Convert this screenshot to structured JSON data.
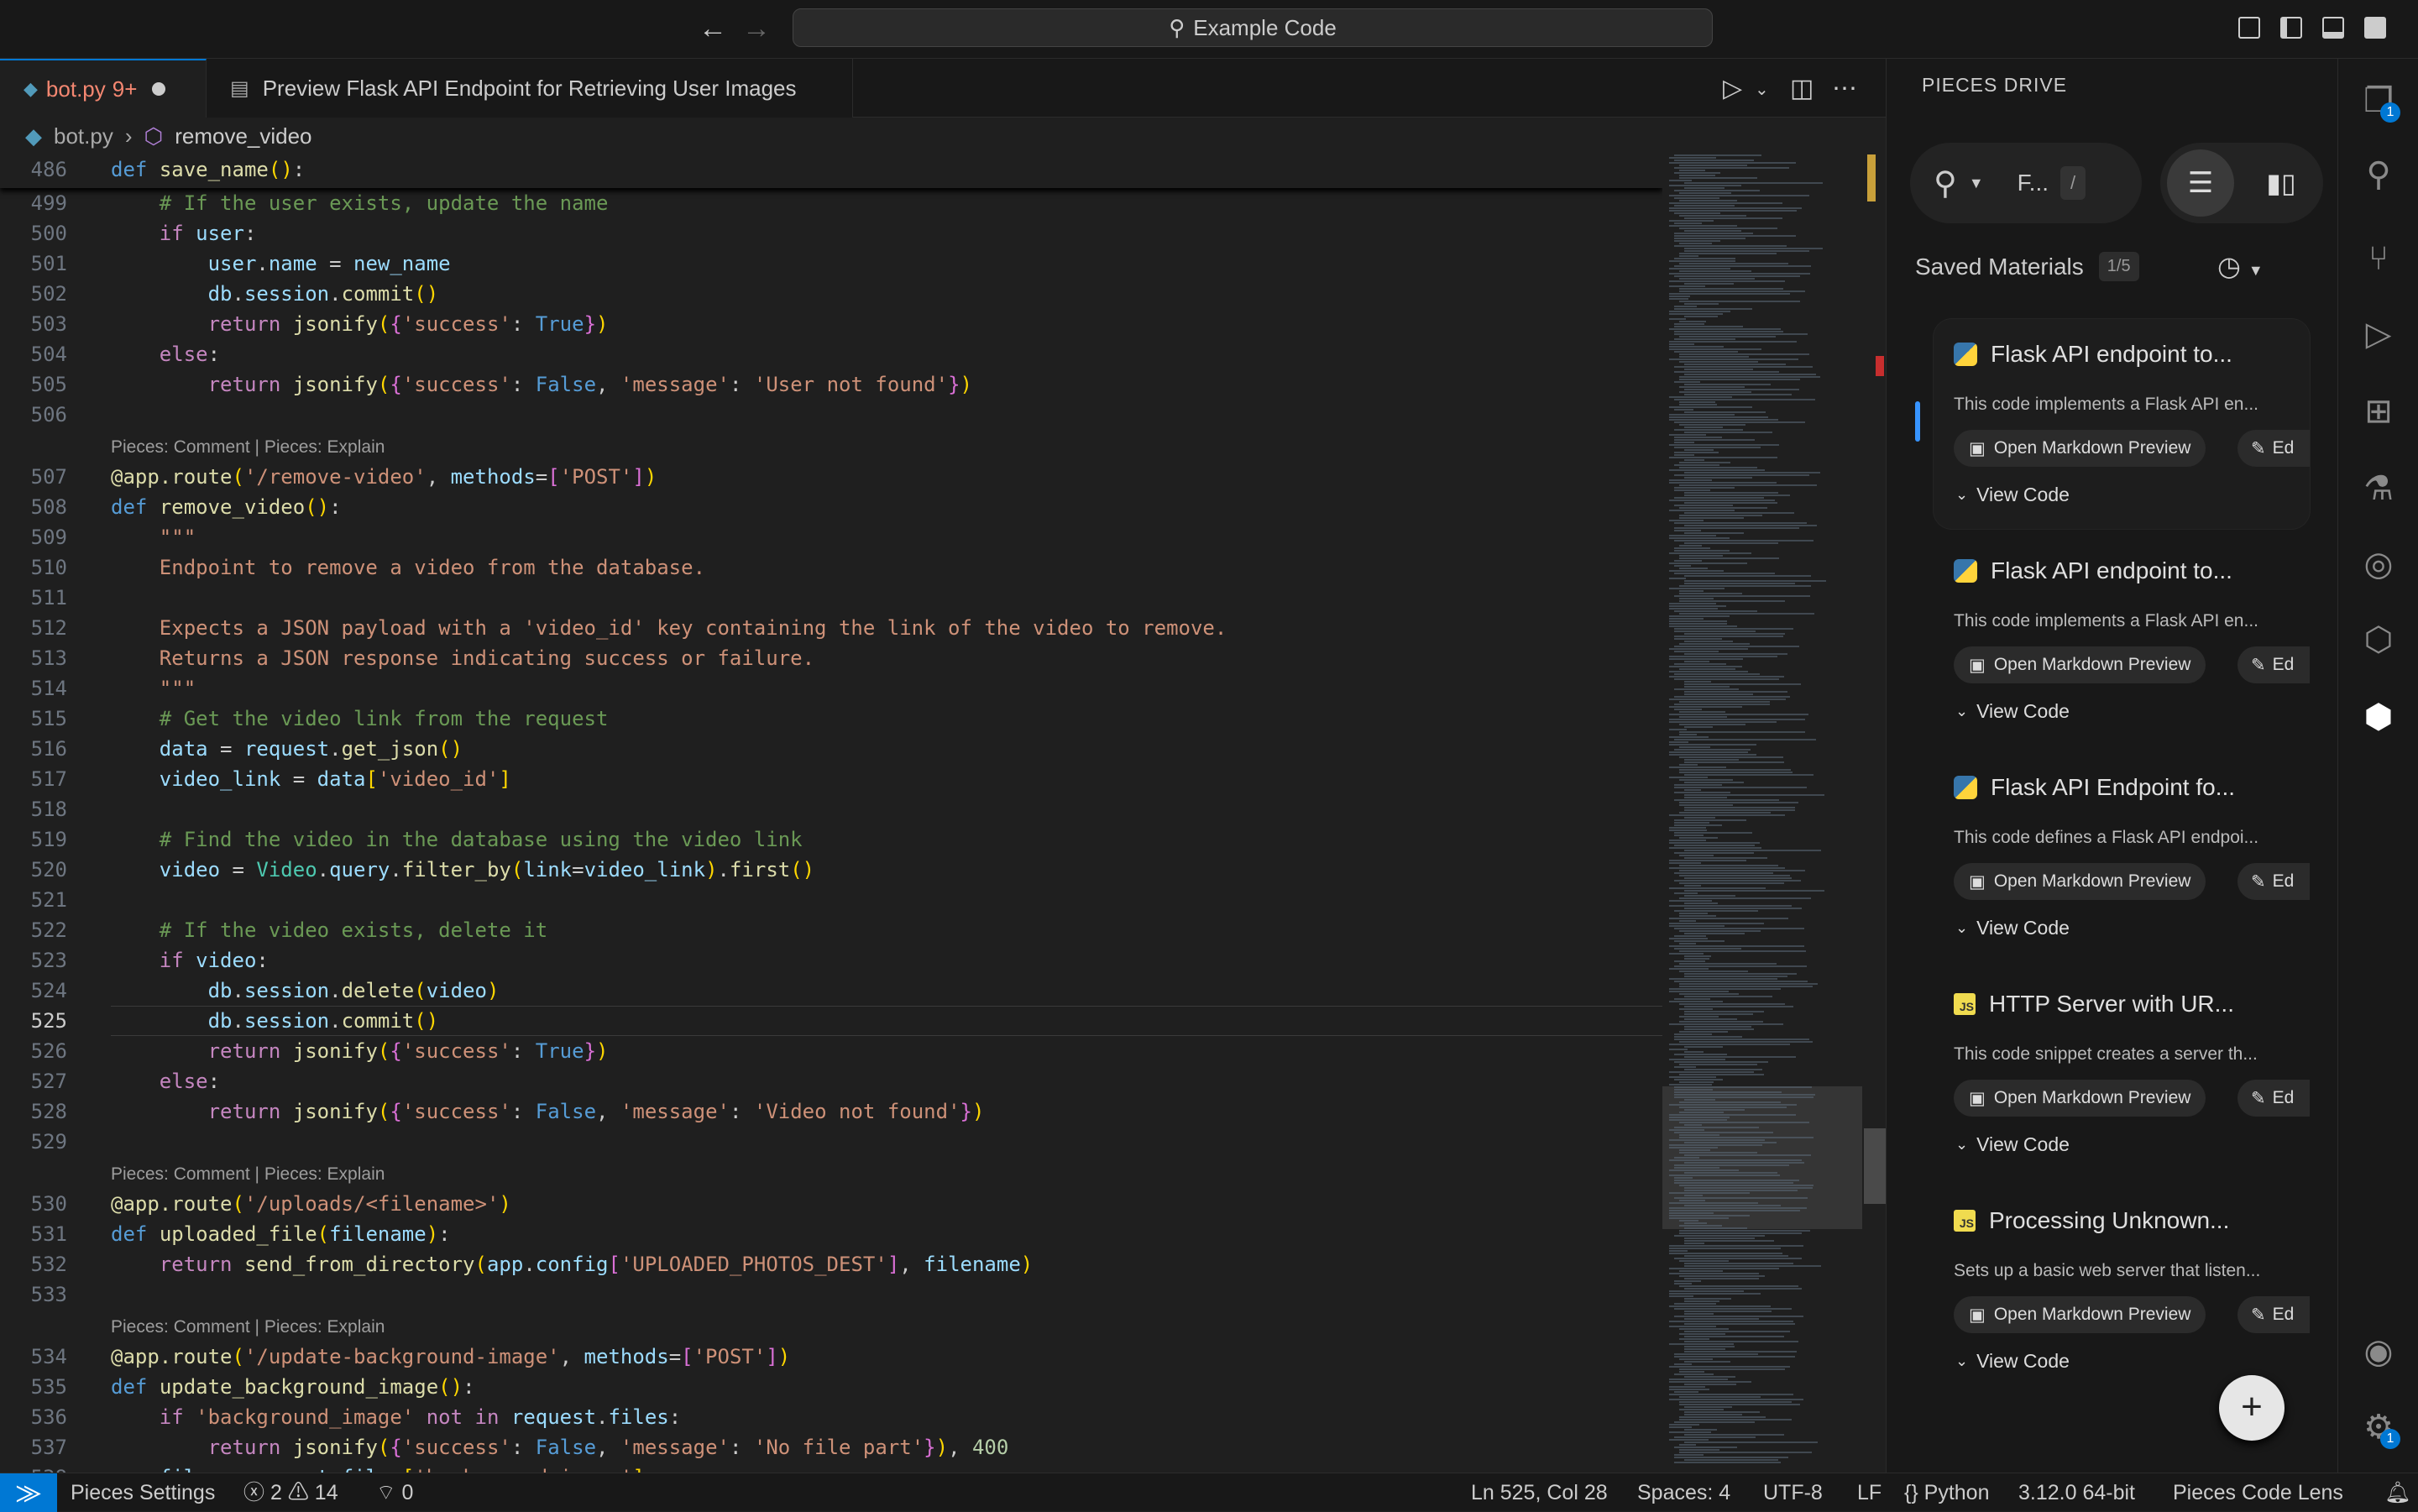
{
  "window": {
    "title": "Example Code"
  },
  "tabs": [
    {
      "label": "bot.py",
      "badge": "9+"
    },
    {
      "label": "Preview Flask API Endpoint for Retrieving User Images"
    }
  ],
  "breadcrumb": {
    "file": "bot.py",
    "symbol": "remove_video"
  },
  "sticky": {
    "line": "486",
    "code": "def save_name():"
  },
  "code_lens": "Pieces: Comment | Pieces: Explain",
  "code_lines": [
    {
      "n": "499",
      "t": "    # If the user exists, update the name"
    },
    {
      "n": "500",
      "t": "    if user:"
    },
    {
      "n": "501",
      "t": "        user.name = new_name"
    },
    {
      "n": "502",
      "t": "        db.session.commit()"
    },
    {
      "n": "503",
      "t": "        return jsonify({'success': True})"
    },
    {
      "n": "504",
      "t": "    else:"
    },
    {
      "n": "505",
      "t": "        return jsonify({'success': False, 'message': 'User not found'})"
    },
    {
      "n": "506",
      "t": ""
    },
    {
      "n": "507",
      "t": "@app.route('/remove-video', methods=['POST'])"
    },
    {
      "n": "508",
      "t": "def remove_video():"
    },
    {
      "n": "509",
      "t": "    \"\"\""
    },
    {
      "n": "510",
      "t": "    Endpoint to remove a video from the database."
    },
    {
      "n": "511",
      "t": ""
    },
    {
      "n": "512",
      "t": "    Expects a JSON payload with a 'video_id' key containing the link of the video to remove."
    },
    {
      "n": "513",
      "t": "    Returns a JSON response indicating success or failure."
    },
    {
      "n": "514",
      "t": "    \"\"\""
    },
    {
      "n": "515",
      "t": "    # Get the video link from the request"
    },
    {
      "n": "516",
      "t": "    data = request.get_json()"
    },
    {
      "n": "517",
      "t": "    video_link = data['video_id']"
    },
    {
      "n": "518",
      "t": ""
    },
    {
      "n": "519",
      "t": "    # Find the video in the database using the video link"
    },
    {
      "n": "520",
      "t": "    video = Video.query.filter_by(link=video_link).first()"
    },
    {
      "n": "521",
      "t": ""
    },
    {
      "n": "522",
      "t": "    # If the video exists, delete it"
    },
    {
      "n": "523",
      "t": "    if video:"
    },
    {
      "n": "524",
      "t": "        db.session.delete(video)"
    },
    {
      "n": "525",
      "t": "        db.session.commit()"
    },
    {
      "n": "526",
      "t": "        return jsonify({'success': True})"
    },
    {
      "n": "527",
      "t": "    else:"
    },
    {
      "n": "528",
      "t": "        return jsonify({'success': False, 'message': 'Video not found'})"
    },
    {
      "n": "529",
      "t": ""
    },
    {
      "n": "530",
      "t": "@app.route('/uploads/<filename>')"
    },
    {
      "n": "531",
      "t": "def uploaded_file(filename):"
    },
    {
      "n": "532",
      "t": "    return send_from_directory(app.config['UPLOADED_PHOTOS_DEST'], filename)"
    },
    {
      "n": "533",
      "t": ""
    },
    {
      "n": "534",
      "t": "@app.route('/update-background-image', methods=['POST'])"
    },
    {
      "n": "535",
      "t": "def update_background_image():"
    },
    {
      "n": "536",
      "t": "    if 'background_image' not in request.files:"
    },
    {
      "n": "537",
      "t": "        return jsonify({'success': False, 'message': 'No file part'}), 400"
    },
    {
      "n": "538",
      "t": "    file = request.files['background_image']"
    }
  ],
  "pieces": {
    "title": "PIECES DRIVE",
    "search_text": "F...",
    "search_hint": "/",
    "saved_label": "Saved Materials",
    "saved_count": "1/5",
    "open_md": "Open Markdown Preview",
    "edit": "Ed",
    "view_code": "View Code",
    "cards": [
      {
        "lang": "python",
        "title": "Flask API endpoint to...",
        "desc": "This code implements a Flask API en..."
      },
      {
        "lang": "python",
        "title": "Flask API endpoint to...",
        "desc": "This code implements a Flask API en..."
      },
      {
        "lang": "python",
        "title": "Flask API Endpoint fo...",
        "desc": "This code defines a Flask API endpoi..."
      },
      {
        "lang": "javascript",
        "title": "HTTP Server with UR...",
        "desc": "This code snippet creates a server th..."
      },
      {
        "lang": "javascript",
        "title": "Processing Unknown...",
        "desc": "Sets up a basic web server that listen..."
      }
    ],
    "js_label": "JS"
  },
  "activity_badges": {
    "explorer": "1",
    "settings": "1"
  },
  "status": {
    "pieces_settings": "Pieces Settings",
    "errors": "2",
    "warnings": "14",
    "ports": "0",
    "position": "Ln 525, Col 28",
    "spaces": "Spaces: 4",
    "encoding": "UTF-8",
    "eol": "LF",
    "language": "Python",
    "interpreter": "3.12.0 64-bit",
    "lens": "Pieces Code Lens"
  }
}
